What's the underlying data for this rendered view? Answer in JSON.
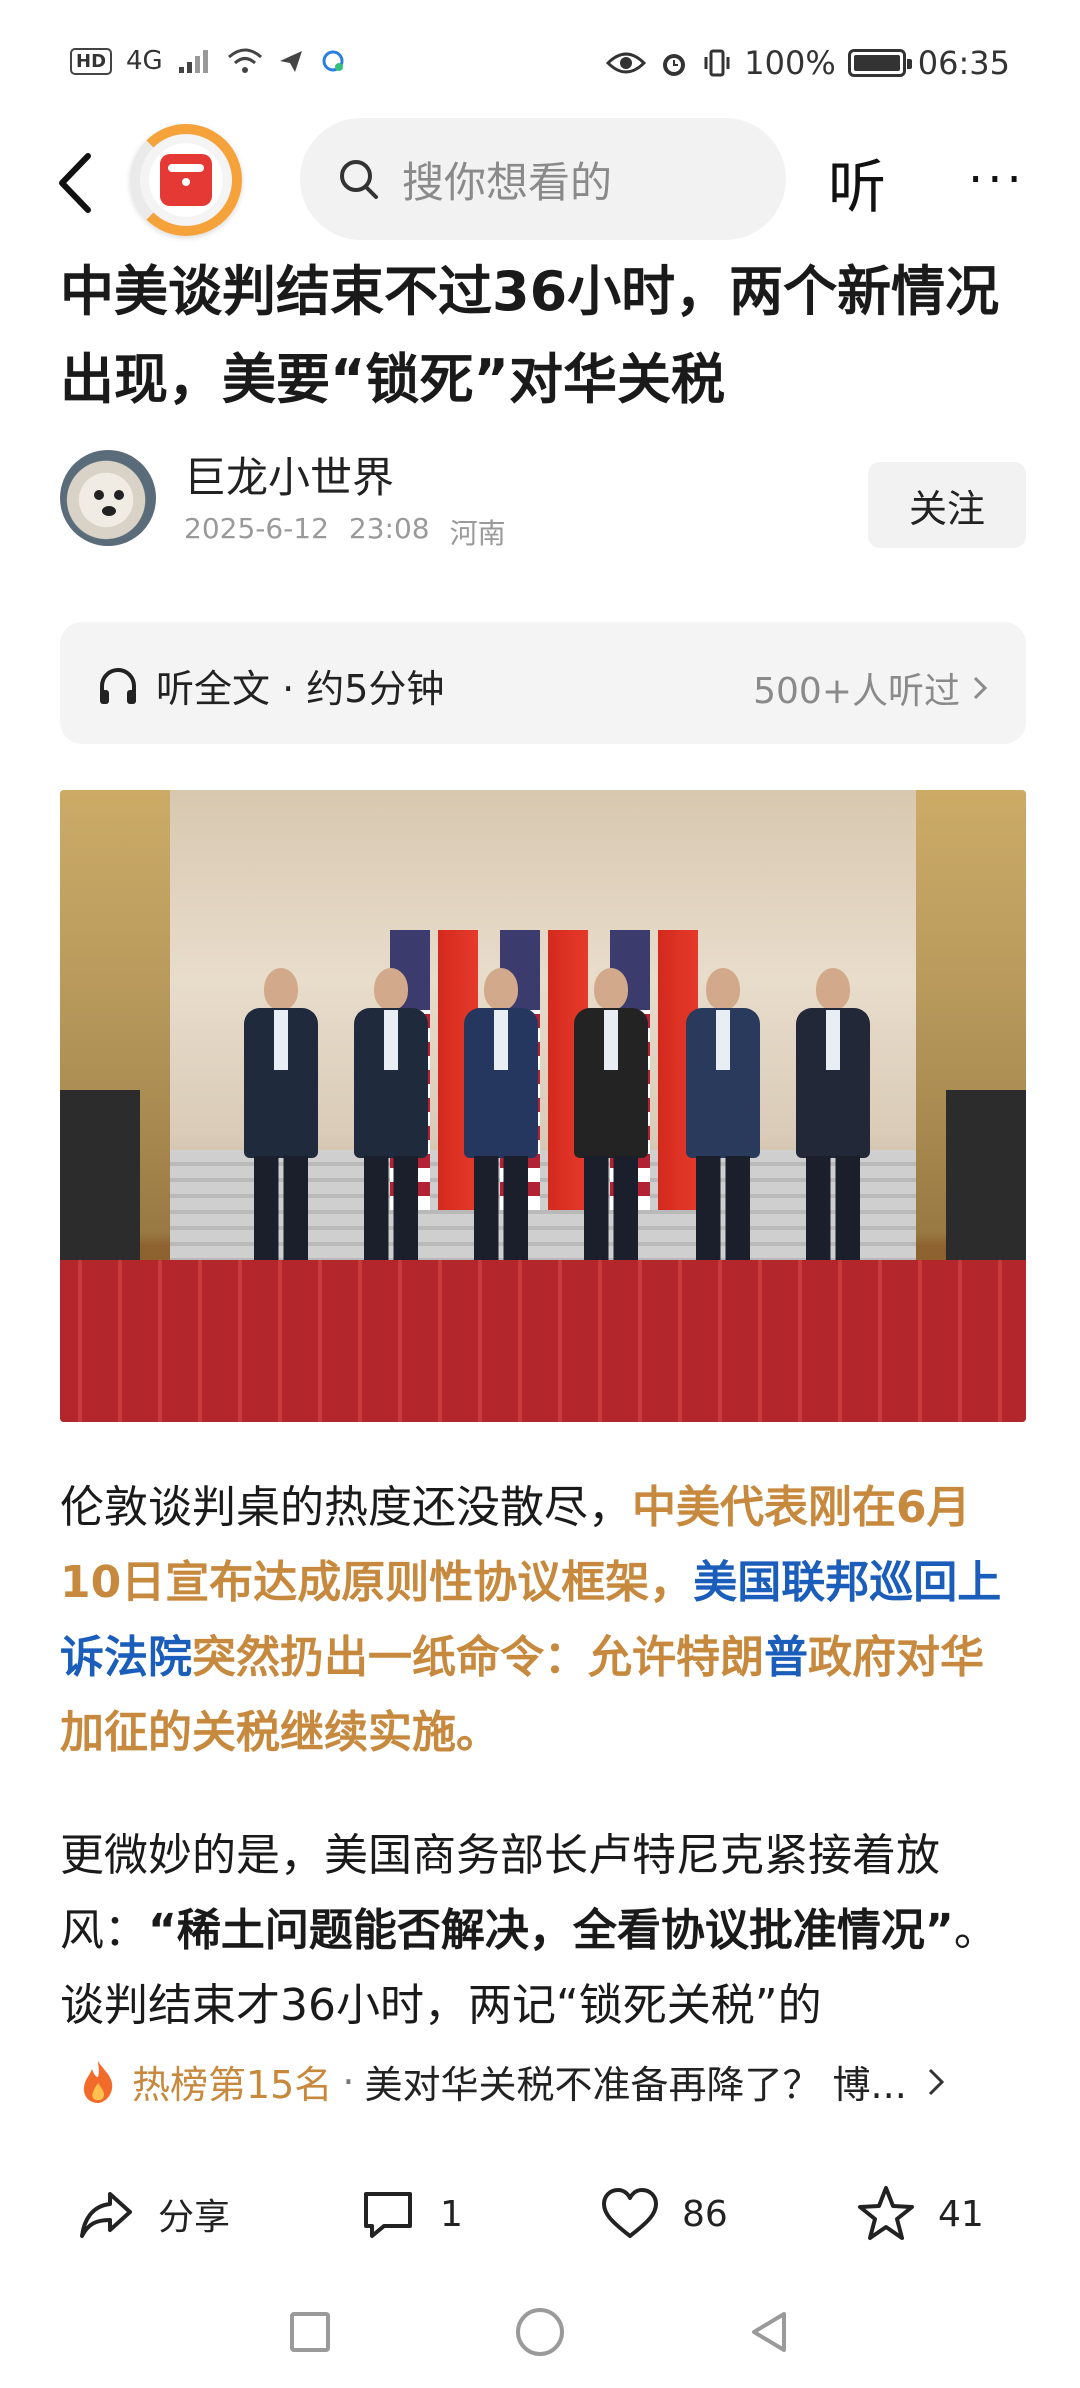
{
  "status_bar": {
    "hd": "HD",
    "network": "4G",
    "battery_text": "100%",
    "battery_level": 1.0,
    "time": "06:35"
  },
  "nav": {
    "search_placeholder": "搜你想看的",
    "listen_label": "听",
    "more_label": "···"
  },
  "article": {
    "title": "中美谈判结束不过36小时，两个新情况出现，美要“锁死”对华关税",
    "author": {
      "name": "巨龙小世界",
      "date": "2025-6-12",
      "time": "23:08",
      "location": "河南",
      "follow_label": "关注"
    },
    "listen_bar": {
      "label": "听全文 · 约5分钟",
      "listeners": "500+人听过"
    },
    "paragraph1": {
      "seg1": "伦敦谈判桌的热度还没散尽，",
      "seg2": "中美代表刚在6月10日宣布达成原则性协议框架，",
      "seg3": "美国联邦巡回上诉法院",
      "seg4": "突然扔出一纸命令：允许特朗",
      "seg5": "普",
      "seg6": "政府对华加征的关税继续实施。"
    },
    "paragraph2": {
      "seg1": "更微妙的是，美国商务部长卢特尼克紧接着放风：",
      "seg2": "“稀土问题能否解决，全看协议批准情况”",
      "seg3": "。谈判结束才36小时，两记“锁死关税”的"
    }
  },
  "hot_list": {
    "rank": "热榜第15名",
    "separator": "·",
    "headline": "美对华关税不准备再降了？ 博..."
  },
  "actions": {
    "share": "分享",
    "comments": "1",
    "likes": "86",
    "favorites": "41"
  },
  "colors": {
    "accent_orange": "#c7893e",
    "accent_blue": "#1a5dba",
    "logo_red": "#e53935",
    "logo_orange": "#f6a23a"
  }
}
